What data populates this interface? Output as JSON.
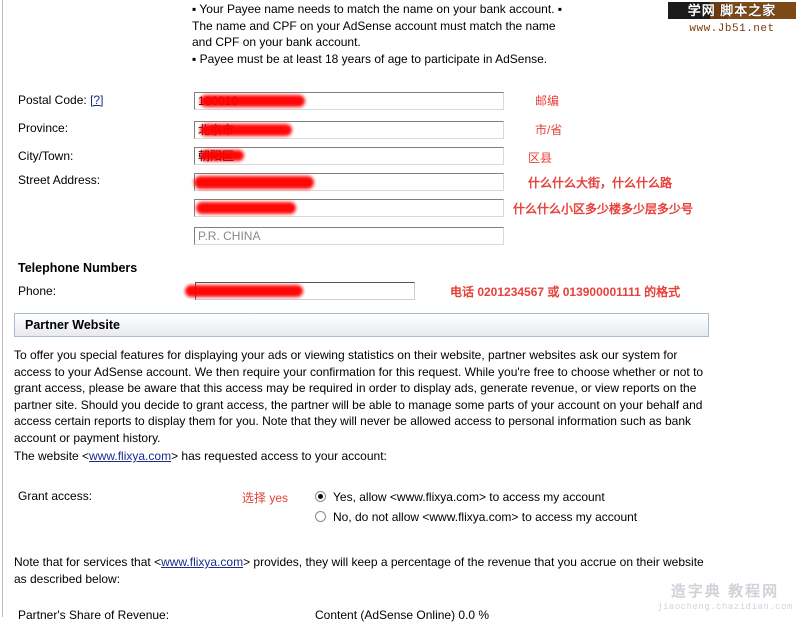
{
  "watermarks": {
    "top_text": "学网 脚本之家",
    "top_url": "www.Jb51.net",
    "bottom_text": "造字典 教程网",
    "bottom_url": "jiaocheng.chazidian.com"
  },
  "notices": {
    "line1": "▪ Your Payee name needs to match the name on your bank account. ▪ The name and CPF on your AdSense account must match the name and CPF on your bank account.",
    "line2": "▪ Payee must be at least 18 years of age to participate in AdSense."
  },
  "address_form": {
    "postal_code_label": "Postal Code:",
    "postal_code_help": "[?]",
    "postal_code_value": "100010",
    "province_label": "Province:",
    "province_value": "北京市",
    "city_label": "City/Town:",
    "city_value": "朝阳区",
    "street_label": "Street Address:",
    "street_line1_value": "",
    "street_line2_value": "",
    "country_value": "P.R. CHINA"
  },
  "annotations": {
    "postal": "邮编",
    "province": "市/省",
    "city": "区县",
    "street1": "什么什么大街，什么什么路",
    "street2": "什么什么小区多少楼多少层多少号",
    "phone": "电话  0201234567  或  013900001111  的格式",
    "grant": "选择  yes"
  },
  "telephone": {
    "heading": "Telephone Numbers",
    "phone_label": "Phone:",
    "phone_value": ""
  },
  "partner_website": {
    "panel_title": "Partner Website",
    "paragraph": "To offer you special features for displaying your ads or viewing statistics on their website, partner websites ask our system for access to your AdSense account. We then require your confirmation for this request. While you're free to choose whether or not to grant access, please be aware that this access may be required in order to display ads, generate revenue, or view reports on the partner site. Should you decide to grant access, the partner will be able to manage some parts of your account on your behalf and access certain reports to display them for you. Note that they will never be allowed access to personal information such as bank account or payment history.",
    "request_prefix": "The website <",
    "site_url": "www.flixya.com",
    "request_suffix": "> has requested access to your account:",
    "grant_label": "Grant access:",
    "options": [
      {
        "label": "Yes, allow <www.flixya.com> to access my account",
        "checked": true
      },
      {
        "label": "No, do not allow <www.flixya.com> to access my account",
        "checked": false
      }
    ],
    "note_prefix": "Note that for services that <",
    "note_suffix": "> provides, they will keep a percentage of the revenue that you accrue on their website as described below:",
    "revenue_label": "Partner's Share of Revenue:",
    "revenue_value": "Content (AdSense Online) 0.0 %"
  },
  "colors": {
    "annotation_red": "#e8403a",
    "link_blue": "#1a2d8a",
    "redaction_red": "#fe0000"
  }
}
